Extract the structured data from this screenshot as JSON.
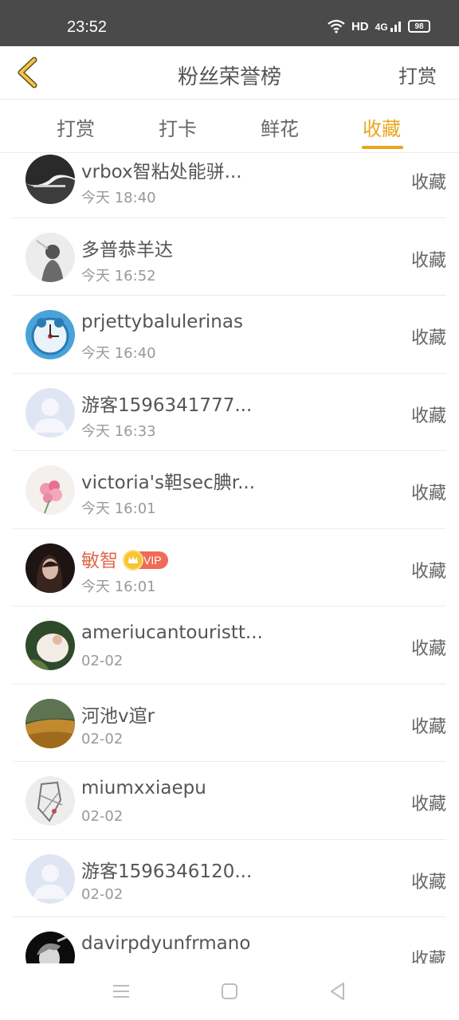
{
  "status_bar": {
    "time": "23:52",
    "network_label": "HD",
    "net_type": "4G",
    "battery": "98"
  },
  "header": {
    "title": "粉丝荣誉榜",
    "action_label": "打赏"
  },
  "tabs": [
    {
      "label": "打赏",
      "active": false
    },
    {
      "label": "打卡",
      "active": false
    },
    {
      "label": "鲜花",
      "active": false
    },
    {
      "label": "收藏",
      "active": true
    }
  ],
  "rows": [
    {
      "name": "vrbox智粘处能骈...",
      "time": "今天 18:40",
      "action": "收藏",
      "avatar": "photo-dark-text"
    },
    {
      "name": "多普恭羊达",
      "time": "今天 16:52",
      "action": "收藏",
      "avatar": "photo-sketch-girl"
    },
    {
      "name": "prjettybalulerinas",
      "time": "今天 16:40",
      "action": "收藏",
      "avatar": "photo-doraemon-clock"
    },
    {
      "name": "游客1596341777...",
      "time": "今天 16:33",
      "action": "收藏",
      "avatar": "default-user"
    },
    {
      "name": "victoria's靼sec腆r...",
      "time": "今天 16:01",
      "action": "收藏",
      "avatar": "photo-flowers"
    },
    {
      "name": "敏智",
      "time": "今天 16:01",
      "action": "收藏",
      "avatar": "photo-dark-girl",
      "vip": "VIP"
    },
    {
      "name": "ameriucantouristt...",
      "time": "02-02",
      "action": "收藏",
      "avatar": "photo-garden"
    },
    {
      "name": "河池v逭r",
      "time": "02-02",
      "action": "收藏",
      "avatar": "photo-landscape"
    },
    {
      "name": "miumxxiaepu",
      "time": "02-02",
      "action": "收藏",
      "avatar": "photo-sketch-figure"
    },
    {
      "name": "游客1596346120...",
      "time": "02-02",
      "action": "收藏",
      "avatar": "default-user"
    },
    {
      "name": "davirpdyunfrmano",
      "time": "",
      "action": "收藏",
      "avatar": "photo-bw-portrait"
    }
  ],
  "colors": {
    "accent": "#eba51e",
    "vip": "#e0684c",
    "status_bar": "#4a4a4a"
  }
}
